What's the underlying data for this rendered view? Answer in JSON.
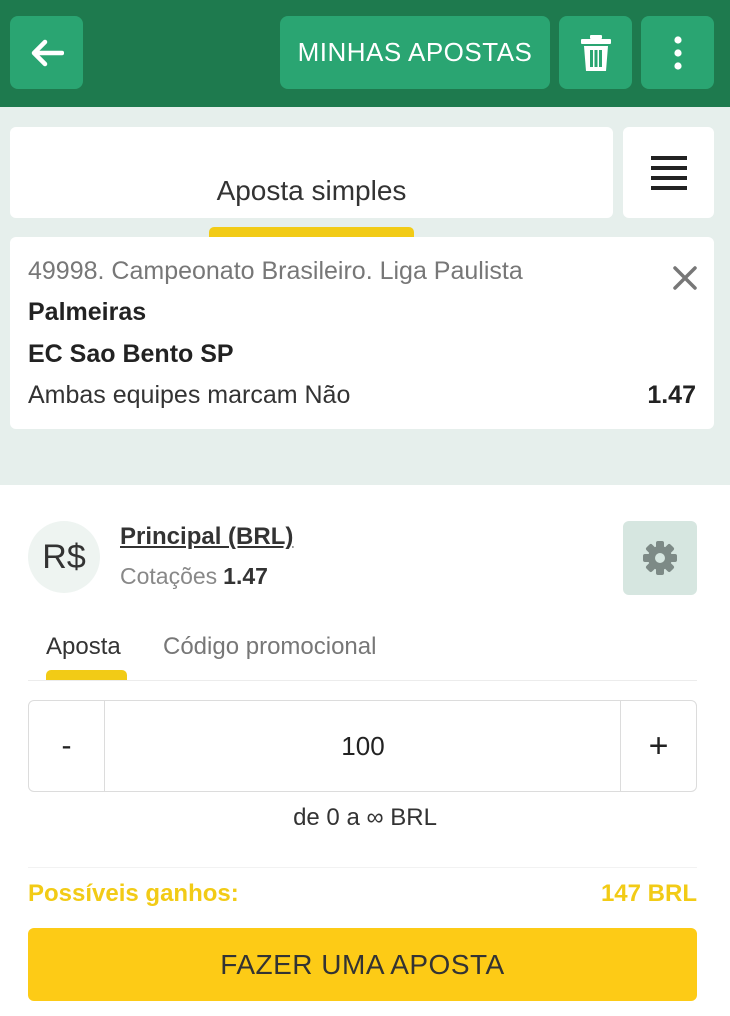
{
  "topbar": {
    "back_icon": "arrow-left-icon",
    "my_bets_label": "MINHAS APOSTAS",
    "trash_icon": "trash-icon",
    "more_icon": "more-vertical-icon"
  },
  "tabs": {
    "active_label": "Aposta simples",
    "menu_icon": "hamburger-menu-icon"
  },
  "bet": {
    "league": "49998. Campeonato Brasileiro. Liga Paulista",
    "team1": "Palmeiras",
    "team2": "EC Sao Bento SP",
    "market": "Ambas equipes marcam Não",
    "odds": "1.47",
    "close_icon": "close-icon"
  },
  "account": {
    "currency_symbol": "R$",
    "name": "Principal (BRL)",
    "coef_label": "Cotações",
    "coef_value": "1.47",
    "settings_icon": "gear-icon"
  },
  "stake_tabs": [
    {
      "label": "Aposta",
      "active": true
    },
    {
      "label": "Código promocional",
      "active": false
    }
  ],
  "stake": {
    "minus_label": "-",
    "plus_label": "+",
    "value": "100",
    "range_text": "de 0 a ∞ BRL"
  },
  "winnings": {
    "label": "Possíveis ganhos:",
    "value": "147 BRL"
  },
  "place_bet_label": "FAZER UMA APOSTA",
  "colors": {
    "topbar": "#1e7a4e",
    "topbar_button": "#2aa572",
    "accent_yellow": "#f2cb16",
    "background_light": "#e6efec"
  }
}
